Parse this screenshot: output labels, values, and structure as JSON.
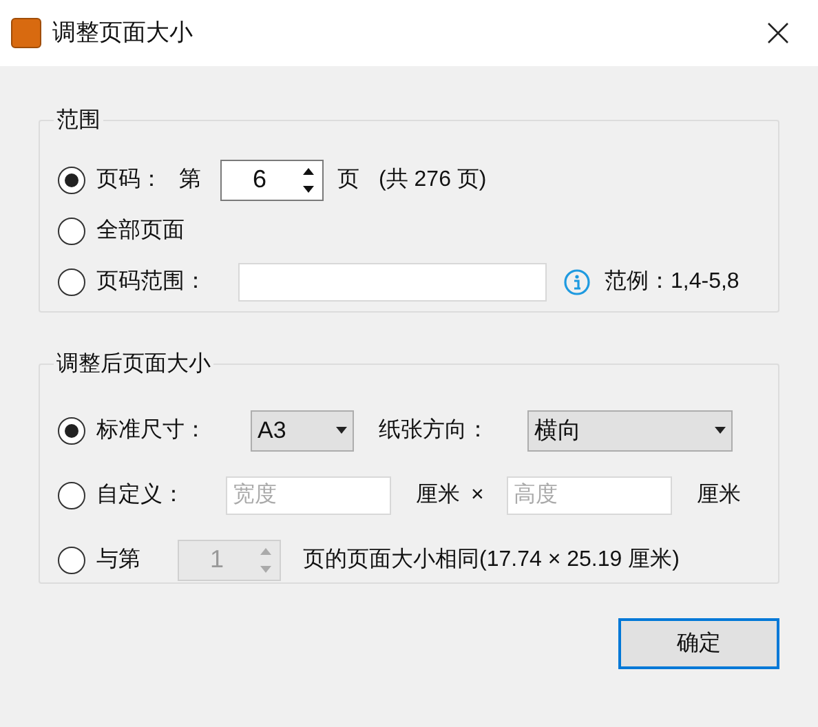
{
  "window": {
    "title": "调整页面大小"
  },
  "range_group": {
    "title": "范围",
    "options": [
      {
        "kind": "page",
        "selected": true,
        "label": "页码：",
        "prefix": "第",
        "spinner": {
          "value": "6",
          "disabled": false
        },
        "suffix": "页",
        "total": "(共 276 页)"
      },
      {
        "kind": "all",
        "selected": false,
        "label": "全部页面"
      },
      {
        "kind": "range",
        "selected": false,
        "label": "页码范围：",
        "example": "范例：1,4-5,8"
      }
    ]
  },
  "size_group": {
    "title": "调整后页面大小",
    "options": [
      {
        "kind": "standard",
        "selected": true,
        "label": "标准尺寸：",
        "size": "A3",
        "orientation_label": "纸张方向：",
        "orientation": "横向"
      },
      {
        "kind": "custom",
        "selected": false,
        "label": "自定义：",
        "width_placeholder": "宽度",
        "unit": "厘米",
        "times": "×",
        "height_placeholder": "高度",
        "unit_end": "厘米",
        "disabled": true
      },
      {
        "kind": "same",
        "selected": false,
        "label": "与第",
        "spinner": {
          "value": "1",
          "disabled": true
        },
        "text": "页的页面大小相同(17.74 × 25.19 厘米)"
      }
    ]
  },
  "ok_button": "确定"
}
